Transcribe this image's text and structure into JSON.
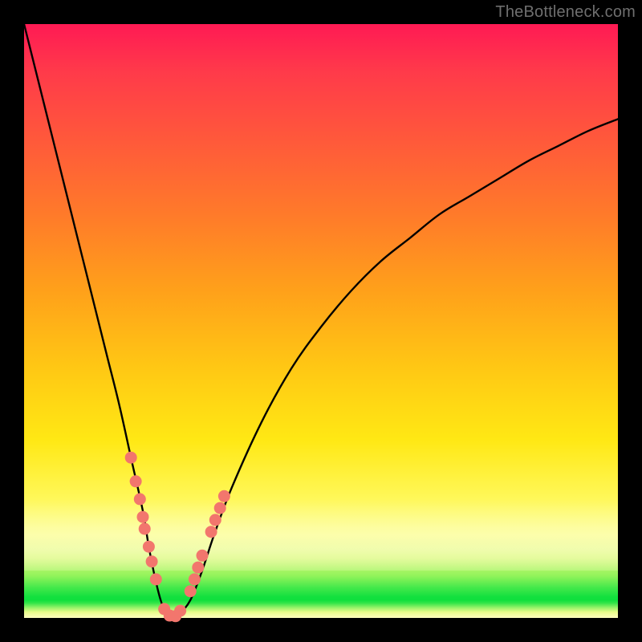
{
  "watermark": "TheBottleneck.com",
  "colors": {
    "frame": "#000000",
    "curve": "#000000",
    "marker_fill": "#f2766d",
    "marker_stroke": "#c94f44"
  },
  "chart_data": {
    "type": "line",
    "title": "",
    "xlabel": "",
    "ylabel": "",
    "xlim": [
      0,
      100
    ],
    "ylim": [
      0,
      100
    ],
    "x": [
      0,
      2,
      4,
      6,
      8,
      10,
      12,
      14,
      16,
      18,
      20,
      21,
      22,
      23,
      24,
      25,
      26,
      28,
      30,
      32,
      35,
      40,
      45,
      50,
      55,
      60,
      65,
      70,
      75,
      80,
      85,
      90,
      95,
      100
    ],
    "y": [
      100,
      92,
      84,
      76,
      68,
      60,
      52,
      44,
      36,
      27,
      18,
      12,
      7,
      3,
      0.5,
      0,
      0.5,
      3,
      8,
      14,
      22,
      33,
      42,
      49,
      55,
      60,
      64,
      68,
      71,
      74,
      77,
      79.5,
      82,
      84
    ],
    "minimum_x": 25,
    "markers": [
      {
        "x": 18.0,
        "y": 27
      },
      {
        "x": 18.8,
        "y": 23
      },
      {
        "x": 19.5,
        "y": 20
      },
      {
        "x": 20.0,
        "y": 17
      },
      {
        "x": 20.3,
        "y": 15
      },
      {
        "x": 21.0,
        "y": 12
      },
      {
        "x": 21.5,
        "y": 9.5
      },
      {
        "x": 22.2,
        "y": 6.5
      },
      {
        "x": 23.6,
        "y": 1.5
      },
      {
        "x": 24.5,
        "y": 0.4
      },
      {
        "x": 25.5,
        "y": 0.3
      },
      {
        "x": 26.3,
        "y": 1.2
      },
      {
        "x": 28.0,
        "y": 4.5
      },
      {
        "x": 28.7,
        "y": 6.5
      },
      {
        "x": 29.3,
        "y": 8.5
      },
      {
        "x": 30.0,
        "y": 10.5
      },
      {
        "x": 31.5,
        "y": 14.5
      },
      {
        "x": 32.2,
        "y": 16.5
      },
      {
        "x": 33.0,
        "y": 18.5
      },
      {
        "x": 33.7,
        "y": 20.5
      }
    ]
  }
}
